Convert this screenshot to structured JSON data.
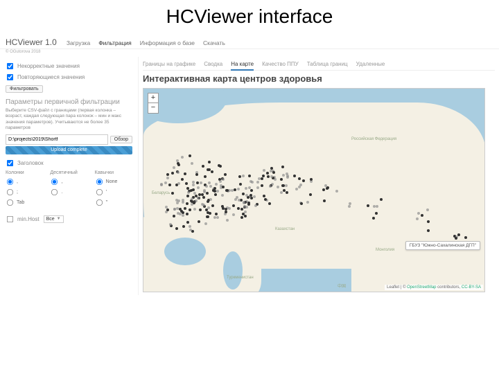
{
  "slide_title": "HCViewer interface",
  "brand": "HCViewer 1.0",
  "copyright": "© OGutorova 2018",
  "nav": {
    "items": [
      "Загрузка",
      "Фильтрация",
      "Информация о базе",
      "Скачать"
    ],
    "active": 1
  },
  "sidebar": {
    "chk_incorrect": "Некорректные значения",
    "chk_duplicate": "Повторяющиеся значения",
    "btn_filter": "Фильтровать",
    "section_params": "Параметры первичной фильтрации",
    "desc": "Выберите CSV-файл с границами (первая колонка – возраст, каждая следующая пара колонок – мин и макс значения параметров). Учитываются не более 35 параметров",
    "path_value": "D:\\projects\\2019\\Shortf",
    "btn_browse": "Обзор",
    "progress": "Upload complete",
    "chk_header": "Заголовок",
    "col_headers": [
      "Колонки",
      "Десятичный",
      "Кавычки"
    ],
    "col1": [
      ",",
      ";",
      "Tab"
    ],
    "col2": [
      ",",
      "."
    ],
    "col3": [
      "None",
      "'",
      "\""
    ],
    "chk_minhost": "min.Host",
    "select_label": "Все"
  },
  "tabs": {
    "items": [
      "Границы на графике",
      "Сводка",
      "На карте",
      "Качество ППУ",
      "Таблица границ",
      "Удаленные"
    ],
    "active": 2
  },
  "map": {
    "title": "Интерактивная карта центров здоровья",
    "zoom_in": "+",
    "zoom_out": "−",
    "labels": {
      "russia": "Российская Федерация",
      "belarus": "Беларусь",
      "kazakhstan": "Казахстан",
      "mongolia": "Монголия",
      "turkmenistan": "Туркменистан",
      "china": "中国"
    },
    "tooltip": "ГБУЗ \"Южно-Сахалинская ДГП\"",
    "attrib_prefix": "Leaflet | © ",
    "attrib_link1": "OpenStreetMap",
    "attrib_mid": " contributors, ",
    "attrib_link2": "CC-BY-SA"
  }
}
